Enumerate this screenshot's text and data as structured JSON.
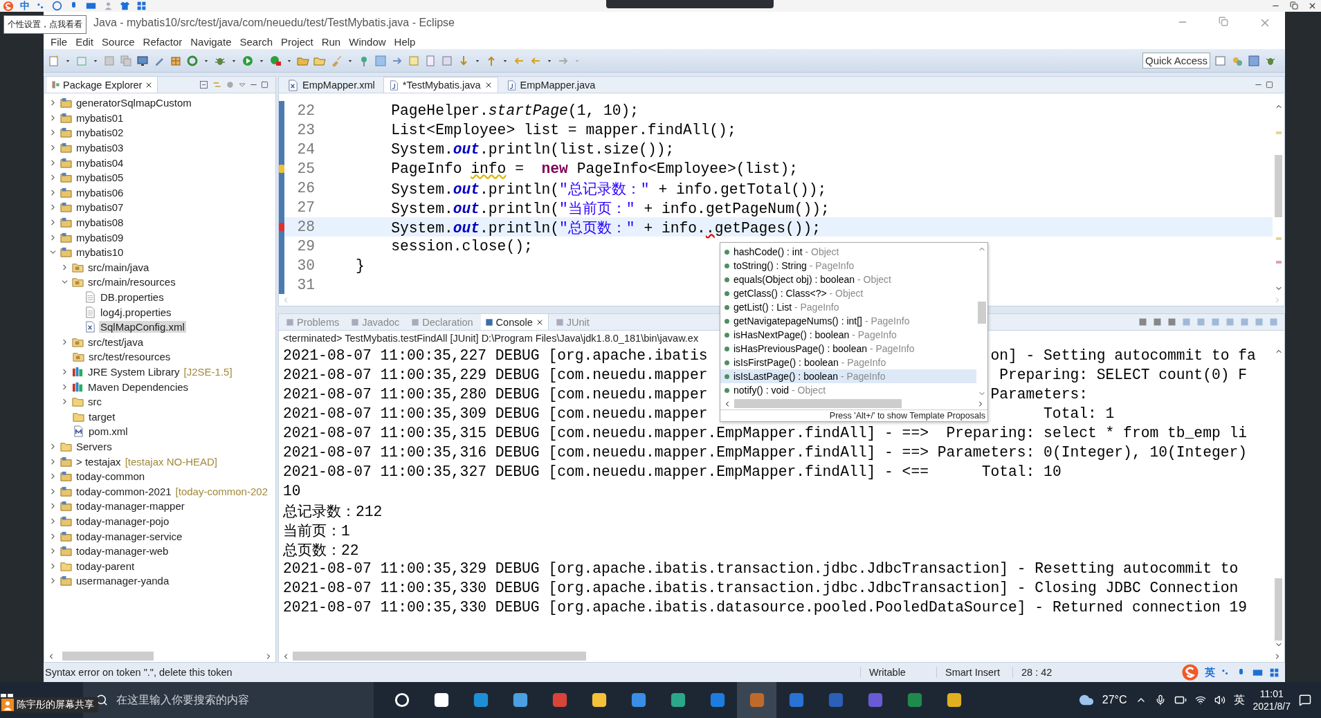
{
  "ime_bar": {
    "mode": "中"
  },
  "tooltip": "个性设置，点我看看",
  "window": {
    "title": "Java - mybatis10/src/test/java/com/neuedu/test/TestMybatis.java - Eclipse"
  },
  "menu": [
    "File",
    "Edit",
    "Source",
    "Refactor",
    "Navigate",
    "Search",
    "Project",
    "Run",
    "Window",
    "Help"
  ],
  "quick_access": {
    "placeholder": "Quick Access"
  },
  "package_explorer": {
    "title": "Package Explorer",
    "items": [
      {
        "label": "generatorSqlmapCustom",
        "kind": "project",
        "expanded": false,
        "selected": false
      },
      {
        "label": "mybatis01",
        "kind": "project",
        "expanded": false,
        "selected": false
      },
      {
        "label": "mybatis02",
        "kind": "project",
        "expanded": false,
        "selected": false
      },
      {
        "label": "mybatis03",
        "kind": "project",
        "expanded": false,
        "selected": false
      },
      {
        "label": "mybatis04",
        "kind": "project",
        "expanded": false,
        "selected": false
      },
      {
        "label": "mybatis05",
        "kind": "project",
        "expanded": false,
        "selected": false
      },
      {
        "label": "mybatis06",
        "kind": "project",
        "expanded": false,
        "selected": false
      },
      {
        "label": "mybatis07",
        "kind": "project",
        "expanded": false,
        "selected": false
      },
      {
        "label": "mybatis08",
        "kind": "project",
        "expanded": false,
        "selected": false
      },
      {
        "label": "mybatis09",
        "kind": "project",
        "expanded": false,
        "selected": false
      },
      {
        "label": "mybatis10",
        "kind": "project",
        "expanded": true,
        "selected": false,
        "children": [
          {
            "label": "src/main/java",
            "kind": "source",
            "expanded": false,
            "selected": false
          },
          {
            "label": "src/main/resources",
            "kind": "source",
            "expanded": true,
            "selected": false,
            "children": [
              {
                "label": "DB.properties",
                "kind": "file",
                "selected": false
              },
              {
                "label": "log4j.properties",
                "kind": "file",
                "selected": false
              },
              {
                "label": "SqlMapConfig.xml",
                "kind": "xml",
                "selected": true
              }
            ]
          },
          {
            "label": "src/test/java",
            "kind": "source",
            "expanded": false,
            "selected": false
          },
          {
            "label": "src/test/resources",
            "kind": "source",
            "selected": false
          },
          {
            "label": "JRE System Library",
            "suffix": "[J2SE-1.5]",
            "kind": "library",
            "expanded": false,
            "selected": false
          },
          {
            "label": "Maven Dependencies",
            "kind": "library",
            "expanded": false,
            "selected": false
          },
          {
            "label": "src",
            "kind": "folder",
            "expanded": false,
            "selected": false
          },
          {
            "label": "target",
            "kind": "folder",
            "selected": false
          },
          {
            "label": "pom.xml",
            "kind": "pom",
            "selected": false
          }
        ]
      },
      {
        "label": "Servers",
        "kind": "folder",
        "expanded": false,
        "selected": false
      },
      {
        "label": "> testajax",
        "suffix": "[testajax NO-HEAD]",
        "kind": "project",
        "expanded": false,
        "selected": false
      },
      {
        "label": "today-common",
        "kind": "project",
        "expanded": false,
        "selected": false
      },
      {
        "label": "today-common-2021",
        "suffix": "[today-common-202",
        "kind": "project",
        "expanded": false,
        "selected": false
      },
      {
        "label": "today-manager-mapper",
        "kind": "project",
        "expanded": false,
        "selected": false
      },
      {
        "label": "today-manager-pojo",
        "kind": "project",
        "expanded": false,
        "selected": false
      },
      {
        "label": "today-manager-service",
        "kind": "project",
        "expanded": false,
        "selected": false
      },
      {
        "label": "today-manager-web",
        "kind": "project",
        "expanded": false,
        "selected": false
      },
      {
        "label": "today-parent",
        "kind": "folder",
        "expanded": false,
        "selected": false
      },
      {
        "label": "usermanager-yanda",
        "kind": "project",
        "expanded": false,
        "selected": false
      }
    ]
  },
  "editor": {
    "tabs": [
      {
        "label": "EmpMapper.xml",
        "kind": "xml",
        "selected": false
      },
      {
        "label": "*TestMybatis.java",
        "kind": "java",
        "selected": true
      },
      {
        "label": "EmpMapper.java",
        "kind": "java",
        "selected": false
      }
    ],
    "lines": [
      {
        "number": "22",
        "current": false,
        "warning": false,
        "error": false,
        "tokens": [
          {
            "kind": "plain",
            "text": "        PageHelper."
          },
          {
            "kind": "static",
            "text": "startPage"
          },
          {
            "kind": "plain",
            "text": "(1, 10);"
          }
        ]
      },
      {
        "number": "23",
        "current": false,
        "warning": false,
        "error": false,
        "tokens": [
          {
            "kind": "plain",
            "text": "        List<Employee> list = mapper.findAll();"
          }
        ]
      },
      {
        "number": "24",
        "current": false,
        "warning": false,
        "error": false,
        "tokens": [
          {
            "kind": "plain",
            "text": "        System."
          },
          {
            "kind": "field",
            "text": "out"
          },
          {
            "kind": "plain",
            "text": ".println(list.size());"
          }
        ]
      },
      {
        "number": "25",
        "current": false,
        "warning": true,
        "error": false,
        "tokens": [
          {
            "kind": "plain",
            "text": "        PageInfo "
          },
          {
            "kind": "warned",
            "text": "info"
          },
          {
            "kind": "plain",
            "text": " =  "
          },
          {
            "kind": "keyword",
            "text": "new"
          },
          {
            "kind": "plain",
            "text": " PageInfo<Employee>(list);"
          }
        ]
      },
      {
        "number": "26",
        "current": false,
        "warning": false,
        "error": false,
        "tokens": [
          {
            "kind": "plain",
            "text": "        System."
          },
          {
            "kind": "field",
            "text": "out"
          },
          {
            "kind": "plain",
            "text": ".println("
          },
          {
            "kind": "string",
            "text": "\"总记录数：\""
          },
          {
            "kind": "plain",
            "text": " + info.getTotal());"
          }
        ]
      },
      {
        "number": "27",
        "current": false,
        "warning": false,
        "error": false,
        "tokens": [
          {
            "kind": "plain",
            "text": "        System."
          },
          {
            "kind": "field",
            "text": "out"
          },
          {
            "kind": "plain",
            "text": ".println("
          },
          {
            "kind": "string",
            "text": "\"当前页：\""
          },
          {
            "kind": "plain",
            "text": " + info.getPageNum());"
          }
        ]
      },
      {
        "number": "28",
        "current": true,
        "warning": false,
        "error": true,
        "tokens": [
          {
            "kind": "plain",
            "text": "        System."
          },
          {
            "kind": "field",
            "text": "out"
          },
          {
            "kind": "plain",
            "text": ".println("
          },
          {
            "kind": "string",
            "text": "\"总页数：\""
          },
          {
            "kind": "plain",
            "text": " + info."
          },
          {
            "kind": "error",
            "text": "."
          },
          {
            "kind": "plain",
            "text": "getPages());"
          }
        ]
      },
      {
        "number": "29",
        "current": false,
        "warning": false,
        "error": false,
        "tokens": [
          {
            "kind": "plain",
            "text": "        session.close();"
          }
        ]
      },
      {
        "number": "30",
        "current": false,
        "warning": false,
        "error": false,
        "tokens": [
          {
            "kind": "plain",
            "text": "    }"
          }
        ]
      },
      {
        "number": "31",
        "current": false,
        "warning": false,
        "error": false
      }
    ]
  },
  "completion": {
    "items": [
      {
        "signature": "hashCode() : int",
        "owner": "- Object",
        "selected": false
      },
      {
        "signature": "toString() : String",
        "owner": "- PageInfo",
        "selected": false
      },
      {
        "signature": "equals(Object obj) : boolean",
        "owner": "- Object",
        "selected": false
      },
      {
        "signature": "getClass() : Class<?>",
        "owner": "- Object",
        "selected": false
      },
      {
        "signature": "getList() : List",
        "owner": "- PageInfo",
        "selected": false
      },
      {
        "signature": "getNavigatepageNums() : int[]",
        "owner": "- PageInfo",
        "selected": false
      },
      {
        "signature": "isHasNextPage() : boolean",
        "owner": "- PageInfo",
        "selected": false
      },
      {
        "signature": "isHasPreviousPage() : boolean",
        "owner": "- PageInfo",
        "selected": false
      },
      {
        "signature": "isIsFirstPage() : boolean",
        "owner": "- PageInfo",
        "selected": false
      },
      {
        "signature": "isIsLastPage() : boolean",
        "owner": "- PageInfo",
        "selected": true
      },
      {
        "signature": "notify() : void",
        "owner": "- Object",
        "selected": false
      }
    ],
    "hint": "Press 'Alt+/' to show Template Proposals"
  },
  "bottom_panel": {
    "tabs": [
      {
        "label": "Problems",
        "selected": false
      },
      {
        "label": "Javadoc",
        "selected": false
      },
      {
        "label": "Declaration",
        "selected": false
      },
      {
        "label": "Console",
        "selected": true
      },
      {
        "label": "JUnit",
        "selected": false
      }
    ],
    "process": "<terminated> TestMybatis.testFindAll [JUnit] D:\\Program Files\\Java\\jdk1.8.0_181\\bin\\javaw.ex",
    "console": [
      {
        "text": "2021-08-07 11:00:35,227 DEBUG [org.apache.ibatis",
        "tail": "on] - Setting autocommit to fa"
      },
      {
        "text": "2021-08-07 11:00:35,229 DEBUG [com.neuedu.mapper",
        "tail": " Preparing: SELECT count(0) F"
      },
      {
        "text": "2021-08-07 11:00:35,280 DEBUG [com.neuedu.mapper",
        "tail": "Parameters:"
      },
      {
        "text": "2021-08-07 11:00:35,309 DEBUG [com.neuedu.mapper",
        "tail": "      Total: 1"
      },
      {
        "text": "2021-08-07 11:00:35,315 DEBUG [com.neuedu.mapper.EmpMapper.findAll] - ==>  Preparing: select * from tb_emp li"
      },
      {
        "text": "2021-08-07 11:00:35,316 DEBUG [com.neuedu.mapper.EmpMapper.findAll] - ==> Parameters: 0(Integer), 10(Integer)"
      },
      {
        "text": "2021-08-07 11:00:35,327 DEBUG [com.neuedu.mapper.EmpMapper.findAll] - <==      Total: 10"
      },
      {
        "text": "10"
      },
      {
        "text": "总记录数：212"
      },
      {
        "text": "当前页：1"
      },
      {
        "text": "总页数：22"
      },
      {
        "text": "2021-08-07 11:00:35,329 DEBUG [org.apache.ibatis.transaction.jdbc.JdbcTransaction] - Resetting autocommit to"
      },
      {
        "text": "2021-08-07 11:00:35,330 DEBUG [org.apache.ibatis.transaction.jdbc.JdbcTransaction] - Closing JDBC Connection"
      },
      {
        "text": "2021-08-07 11:00:35,330 DEBUG [org.apache.ibatis.datasource.pooled.PooledDataSource] - Returned connection 19"
      }
    ]
  },
  "status_bar": {
    "message": "Syntax error on token \".\", delete this token",
    "mode": "Writable",
    "insert": "Smart Insert",
    "position": "28 : 42"
  },
  "ime_status": {
    "mode": "英"
  },
  "taskbar": {
    "search": {
      "placeholder": "在这里输入你要搜索的内容"
    },
    "weather": "27°C",
    "language": "英",
    "time": "11:01",
    "date": "2021/8/7"
  },
  "screen_share": {
    "label": "陈宇彤的屏幕共享"
  }
}
